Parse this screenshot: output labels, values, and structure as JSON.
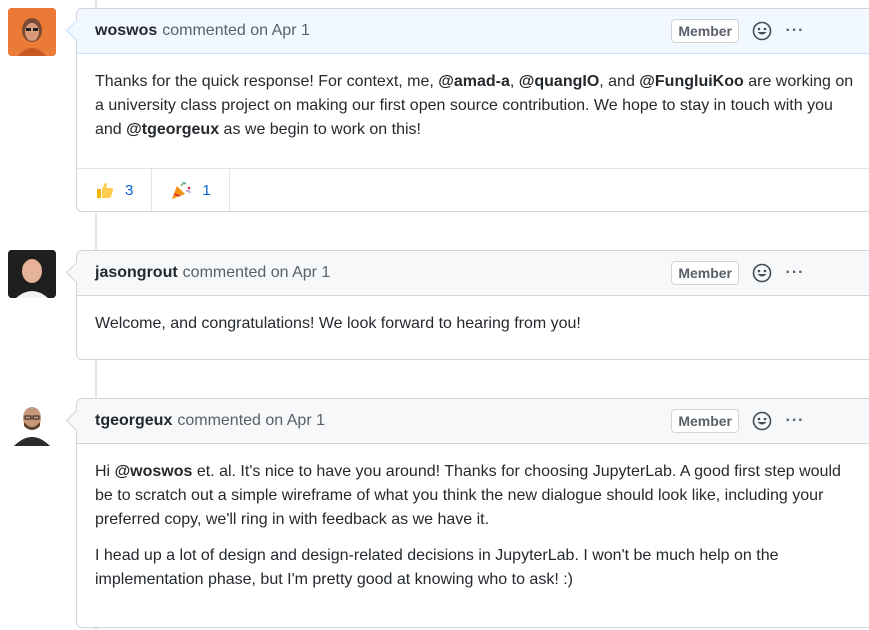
{
  "comments": [
    {
      "author": "woswos",
      "meta": "commented on Apr 1",
      "badge": "Member",
      "body": [
        [
          "Thanks for the quick response! For context, me, ",
          "@amad-a",
          ", ",
          "@quangIO",
          ", and ",
          "@FungluiKoo",
          " are working on a university class project on making our first open source contribution. We hope to stay in touch with you and ",
          "@tgeorgeux",
          " as we begin to work on this!"
        ]
      ],
      "reactions": [
        {
          "icon": "thumbs-up-icon",
          "count": "3"
        },
        {
          "icon": "party-popper-icon",
          "count": "1"
        }
      ]
    },
    {
      "author": "jasongrout",
      "meta": "commented on Apr 1",
      "badge": "Member",
      "body": [
        [
          "Welcome, and congratulations! We look forward to hearing from you!"
        ]
      ]
    },
    {
      "author": "tgeorgeux",
      "meta": "commented on Apr 1",
      "badge": "Member",
      "body": [
        [
          "Hi ",
          "@woswos",
          " et. al. It's nice to have you around! Thanks for choosing JupyterLab. A good first step would be to scratch out a simple wireframe of what you think the new dialogue should look like, including your preferred copy, we'll ring in with feedback as we have it."
        ],
        [
          "I head up a lot of design and design-related decisions in JupyterLab. I won't be much help on the implementation phase, but I'm pretty good at knowing who to ask! :)"
        ]
      ]
    }
  ],
  "ui": {
    "more_label": "···"
  }
}
